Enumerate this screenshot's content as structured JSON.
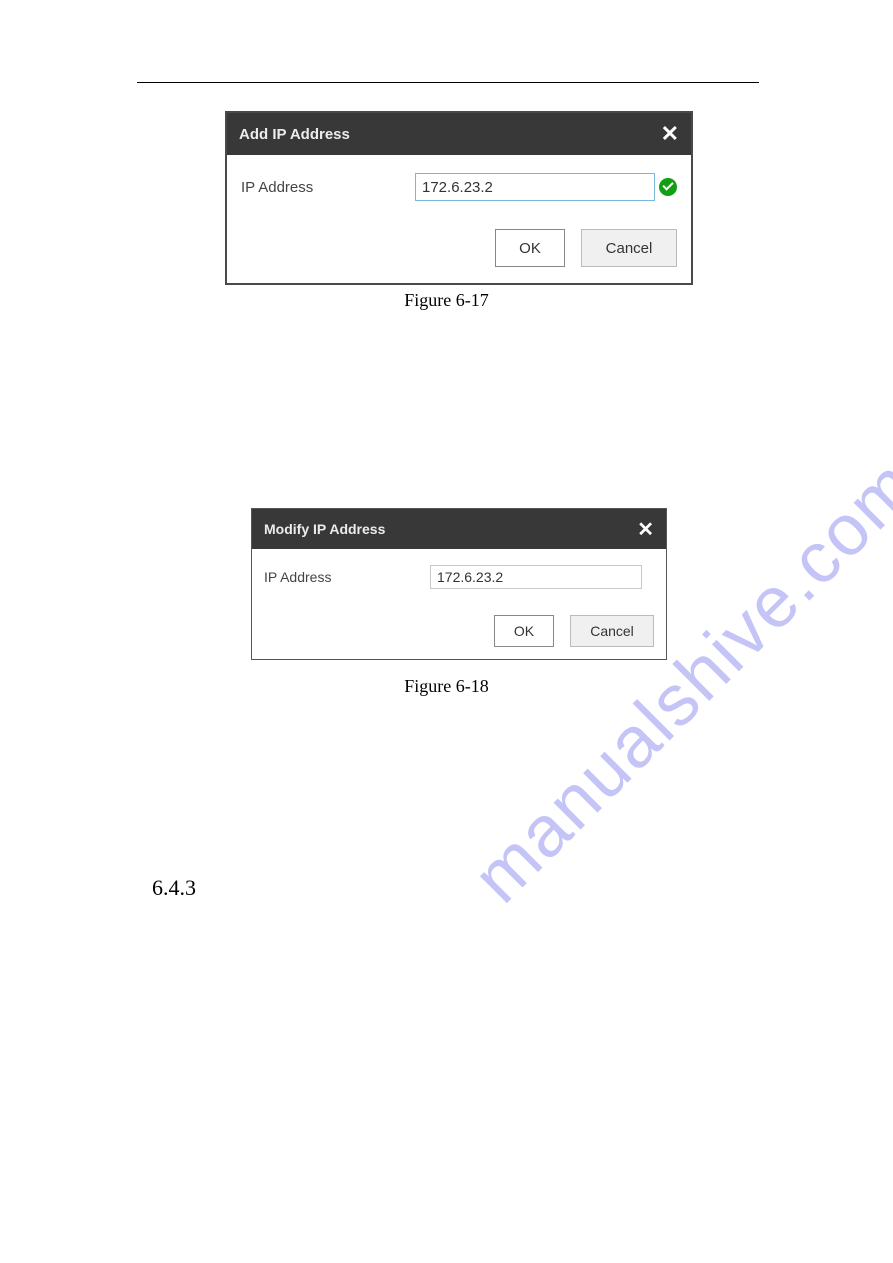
{
  "dialog1": {
    "title": "Add IP Address",
    "field_label": "IP Address",
    "field_value": "172.6.23.2",
    "ok": "OK",
    "cancel": "Cancel"
  },
  "caption1": "Figure 6-17",
  "dialog2": {
    "title": "Modify IP Address",
    "field_label": "IP Address",
    "field_value": "172.6.23.2",
    "ok": "OK",
    "cancel": "Cancel"
  },
  "caption2": "Figure 6-18",
  "section_number": "6.4.3",
  "watermark": "manualshive.com"
}
